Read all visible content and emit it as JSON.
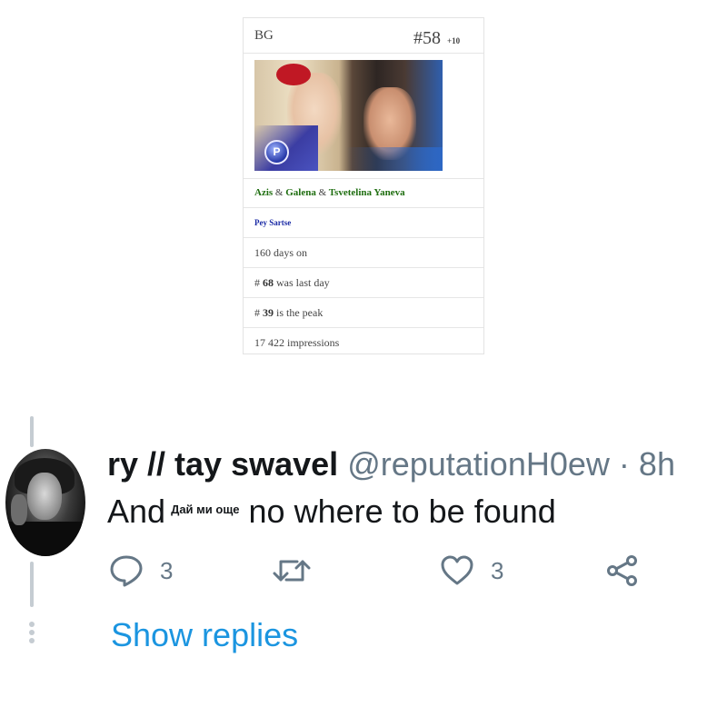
{
  "chart_card": {
    "country": "BG",
    "rank": "#58",
    "rank_change": "+10",
    "cover_logo_letter": "P",
    "artists": [
      {
        "name": "Azis",
        "sep": "&"
      },
      {
        "name": "Galena",
        "sep": "&"
      },
      {
        "name": "Tsvetelina Yaneva",
        "sep": ""
      }
    ],
    "label": "Pey Sartse",
    "days_on": "160 days on",
    "last_day_prefix": "#",
    "last_day_value": "68",
    "last_day_suffix": "was last day",
    "peak_prefix": "#",
    "peak_value": "39",
    "peak_suffix": "is the peak",
    "impressions": "17 422 impressions",
    "colors": {
      "artist_link": "#1f6e10",
      "label_link": "#1a2aa5"
    }
  },
  "tweet": {
    "display_name": "ry // tay swavel",
    "handle": "@reputationH0ew",
    "separator": "·",
    "time": "8h",
    "text_before": "And",
    "text_small": "Дай ми още",
    "text_after": "no where to be found",
    "actions": {
      "reply": {
        "icon": "reply-icon",
        "count": "3"
      },
      "retweet": {
        "icon": "retweet-icon",
        "count": ""
      },
      "like": {
        "icon": "heart-icon",
        "count": "3"
      },
      "share": {
        "icon": "share-icon"
      }
    },
    "show_replies": "Show replies",
    "colors": {
      "link": "#1b95e0",
      "muted": "#657786",
      "text": "#14171a"
    }
  }
}
